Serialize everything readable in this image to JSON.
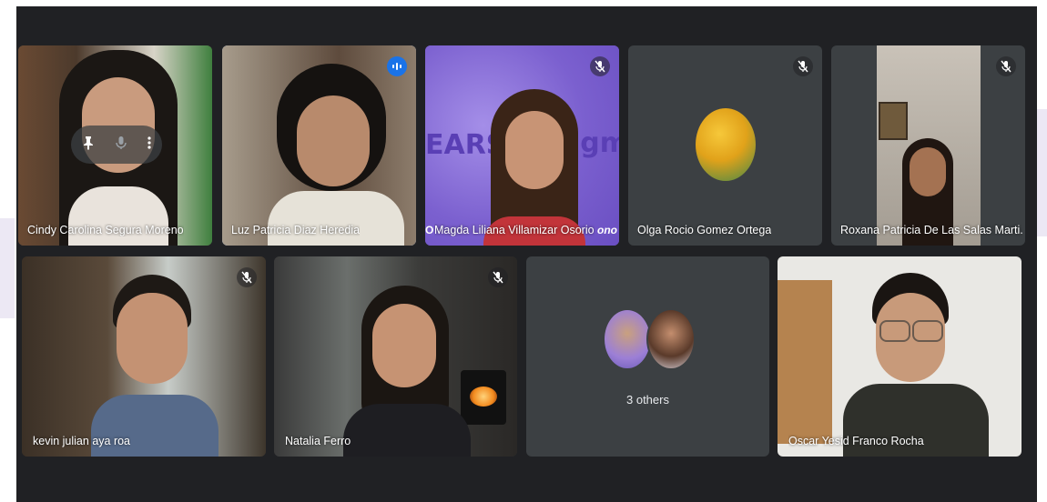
{
  "meeting": {
    "participants": [
      {
        "name": "Cindy Carolina Segura Moreno",
        "mic": "hover-menu"
      },
      {
        "name": "Luz Patricia Diaz Heredia",
        "mic": "speaking"
      },
      {
        "name": "Magda Liliana Villamizar Osorio",
        "mic": "muted"
      },
      {
        "name": "Olga Rocio Gomez Ortega",
        "mic": "muted"
      },
      {
        "name": "Roxana Patricia De Las Salas Marti...",
        "mic": "muted"
      },
      {
        "name": "kevin julian aya roa",
        "mic": "muted"
      },
      {
        "name": "Natalia Ferro",
        "mic": "muted"
      },
      {
        "name": "Oscar Yesid Franco Rocha",
        "mic": "unmuted"
      }
    ],
    "others_label": "3 others",
    "background_text_left": "EARS",
    "background_text_right": "igm",
    "background_text_small_left": "O",
    "background_text_small_right": "ono",
    "icons": {
      "pin": "pin-icon",
      "mic": "microphone-icon",
      "more": "more-vertical-icon",
      "muted": "mic-off-icon",
      "speaking": "audio-levels-icon"
    },
    "colors": {
      "stage": "#202124",
      "tile": "#3c4043",
      "speaking_outline": "#8ab4f8",
      "speaking_badge": "#1a73e8"
    }
  }
}
